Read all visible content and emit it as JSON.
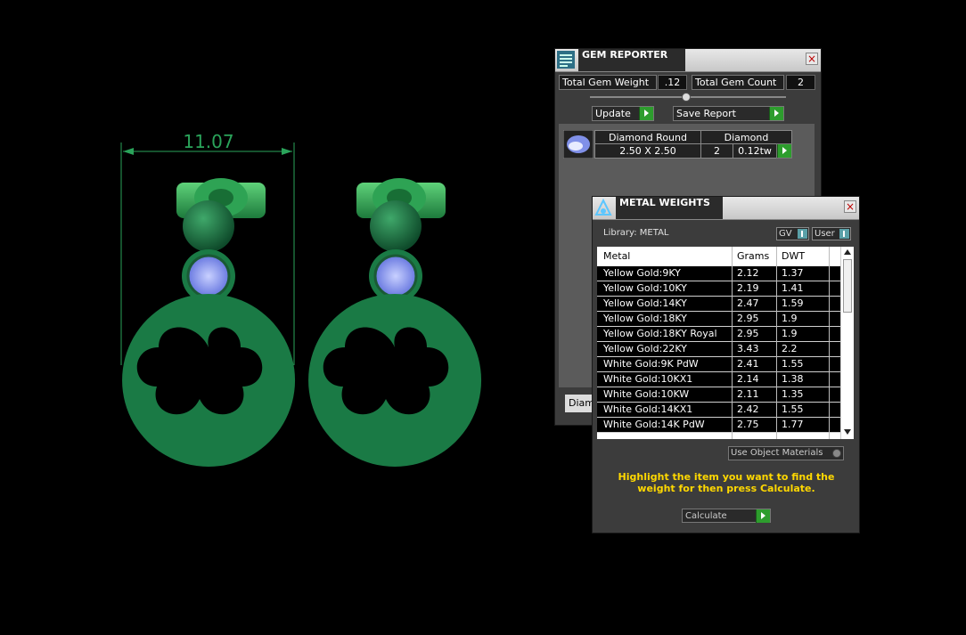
{
  "viewport": {
    "dimension_label": "11.07",
    "model_color": "#1a7a45",
    "stone_color": "#8ea0ff"
  },
  "gem_reporter": {
    "title": "GEM REPORTER",
    "close_glyph": "×",
    "total_weight_label": "Total Gem Weight",
    "total_weight_value": ".12",
    "total_count_label": "Total Gem Count",
    "total_count_value": "2",
    "update_label": "Update",
    "save_report_label": "Save Report",
    "gem_row": {
      "shape": "Diamond Round",
      "material": "Diamond",
      "size": "2.50 X 2.50",
      "count": "2",
      "weight": "0.12tw"
    },
    "bottom_tab_label": "Diam"
  },
  "metal_weights": {
    "title": "METAL WEIGHTS",
    "close_glyph": "×",
    "library_label": "Library: METAL",
    "gv_label": "GV",
    "user_label": "User",
    "columns": [
      "Metal",
      "Grams",
      "DWT"
    ],
    "rows": [
      {
        "metal": "Yellow Gold:9KY",
        "grams": "2.12",
        "dwt": "1.37"
      },
      {
        "metal": "Yellow Gold:10KY",
        "grams": "2.19",
        "dwt": "1.41"
      },
      {
        "metal": "Yellow Gold:14KY",
        "grams": "2.47",
        "dwt": "1.59"
      },
      {
        "metal": "Yellow Gold:18KY",
        "grams": "2.95",
        "dwt": "1.9"
      },
      {
        "metal": "Yellow Gold:18KY Royal",
        "grams": "2.95",
        "dwt": "1.9"
      },
      {
        "metal": "Yellow Gold:22KY",
        "grams": "3.43",
        "dwt": "2.2"
      },
      {
        "metal": "White Gold:9K PdW",
        "grams": "2.41",
        "dwt": "1.55"
      },
      {
        "metal": "White Gold:10KX1",
        "grams": "2.14",
        "dwt": "1.38"
      },
      {
        "metal": "White Gold:10KW",
        "grams": "2.11",
        "dwt": "1.35"
      },
      {
        "metal": "White Gold:14KX1",
        "grams": "2.42",
        "dwt": "1.55"
      },
      {
        "metal": "White Gold:14K PdW",
        "grams": "2.75",
        "dwt": "1.77"
      }
    ],
    "use_object_materials_label": "Use Object Materials",
    "hint_text": "Highlight the item you want to find the weight for then press Calculate.",
    "calculate_label": "Calculate"
  }
}
